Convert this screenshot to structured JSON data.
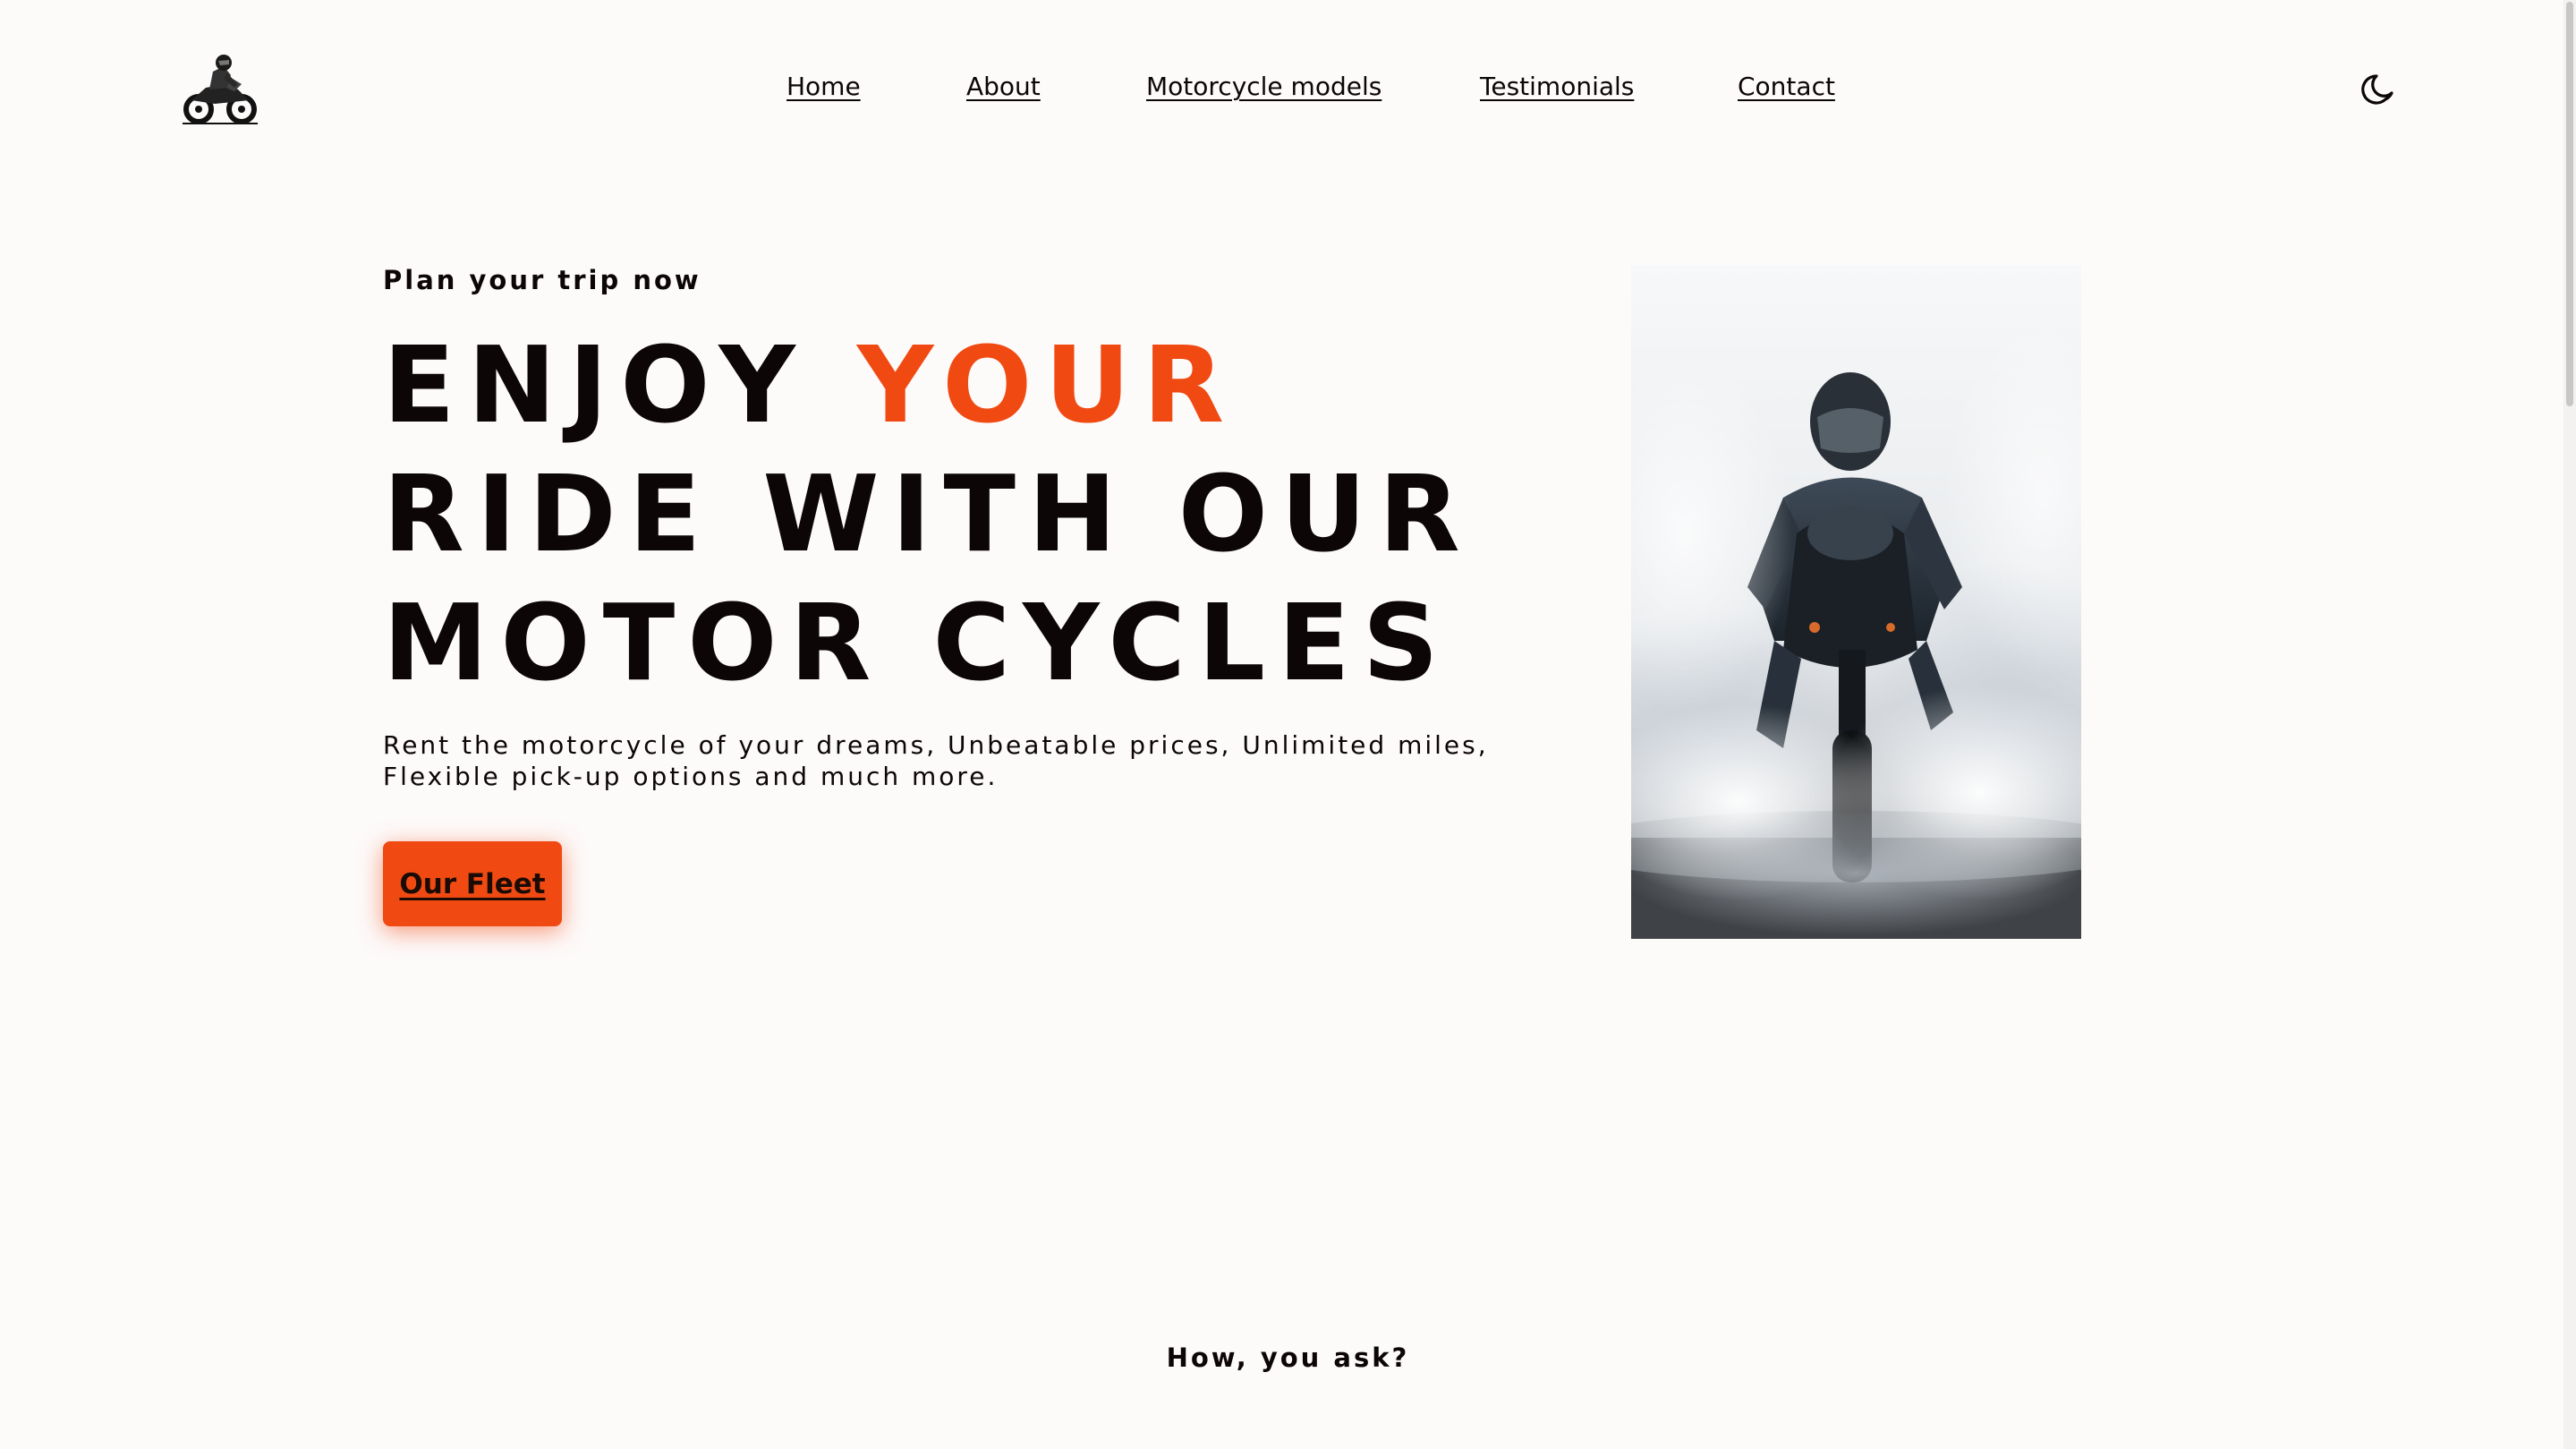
{
  "nav": {
    "items": [
      {
        "label": "Home"
      },
      {
        "label": "About"
      },
      {
        "label": "Motorcycle models"
      },
      {
        "label": "Testimonials"
      },
      {
        "label": "Contact"
      }
    ],
    "theme_icon": "moon-icon",
    "logo_icon": "motorcycle-rider-logo"
  },
  "hero": {
    "eyebrow": "Plan your trip now",
    "headline_part1": "ENJOY ",
    "headline_accent": "YOUR",
    "headline_part2": " RIDE WITH OUR MOTOR CYCLES",
    "lede": "Rent the motorcycle of your dreams, Unbeatable prices, Unlimited miles, Flexible pick-up options and much more.",
    "cta_label": "Our Fleet",
    "photo": "rider-on-motorcycle-in-smoke"
  },
  "next_section": {
    "kicker": "How, you ask?"
  },
  "colors": {
    "background": "#fdfafa",
    "text": "#0d0606",
    "accent": "#f04a12"
  }
}
